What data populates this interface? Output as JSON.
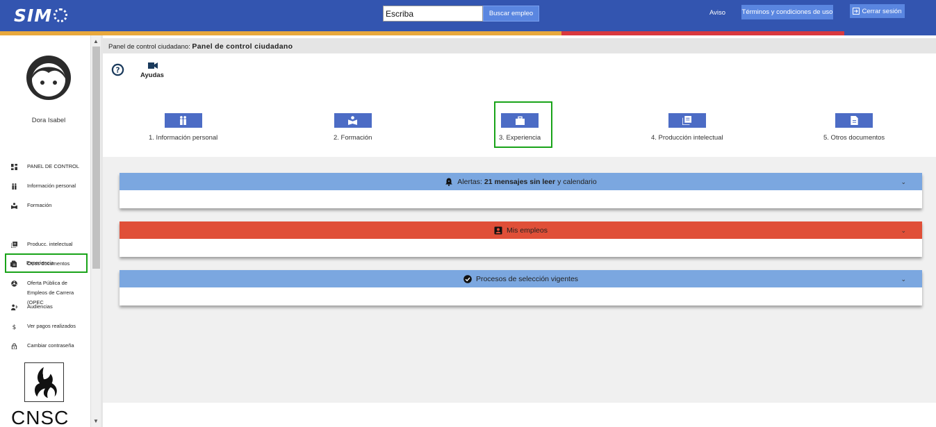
{
  "header": {
    "logo_text": "SIM",
    "search": {
      "value": "Escriba",
      "button": "Buscar empleo"
    },
    "aviso": "Aviso",
    "terms": "Términos y condiciones de uso",
    "logout": "Cerrar sesión",
    "colors": {
      "bar": "#3355b0",
      "stripe_yellow": "#e8a83c",
      "stripe_red": "#d9383f",
      "button": "#5a86e0"
    }
  },
  "sidebar": {
    "user_name": "Dora Isabel",
    "items": [
      {
        "label": "PANEL DE CONTROL",
        "icon": "dashboard-icon"
      },
      {
        "label": "Información personal",
        "icon": "people-icon"
      },
      {
        "label": "Formación",
        "icon": "book-icon"
      },
      {
        "label": "Experiencia",
        "icon": "briefcase-icon",
        "active": true
      },
      {
        "label": "Producc. intelectual",
        "icon": "library-icon"
      },
      {
        "label": "Otros documentos",
        "icon": "document-icon"
      },
      {
        "label": "Oferta Pública de Empleos de Carrera (OPEC",
        "icon": "globe-icon"
      },
      {
        "label": "Audiencias",
        "icon": "audience-icon"
      },
      {
        "label": "Ver pagos realizados",
        "icon": "dollar-icon"
      },
      {
        "label": "Cambiar contraseña",
        "icon": "lock-icon"
      }
    ],
    "footer_logo": "CNSC"
  },
  "main": {
    "breadcrumb_prefix": "Panel de control ciudadano:",
    "breadcrumb_current": "Panel de control ciudadano",
    "help_label": "Ayudas",
    "steps": [
      {
        "label": "1. Información personal",
        "icon": "people-icon"
      },
      {
        "label": "2. Formación",
        "icon": "book-icon"
      },
      {
        "label": "3. Experiencia",
        "icon": "briefcase-icon",
        "active": true
      },
      {
        "label": "4. Producción intelectual",
        "icon": "library-icon"
      },
      {
        "label": "5. Otros documentos",
        "icon": "document-icon"
      }
    ],
    "panels": {
      "alerts": {
        "prefix": "Alertas:",
        "bold": "21 mensajes sin leer",
        "suffix": "y calendario",
        "color": "#7ba7e0"
      },
      "jobs": {
        "title": "Mis empleos",
        "color": "#e04f38"
      },
      "processes": {
        "title": "Procesos de selección vigentes",
        "color": "#7ba7e0"
      }
    }
  }
}
